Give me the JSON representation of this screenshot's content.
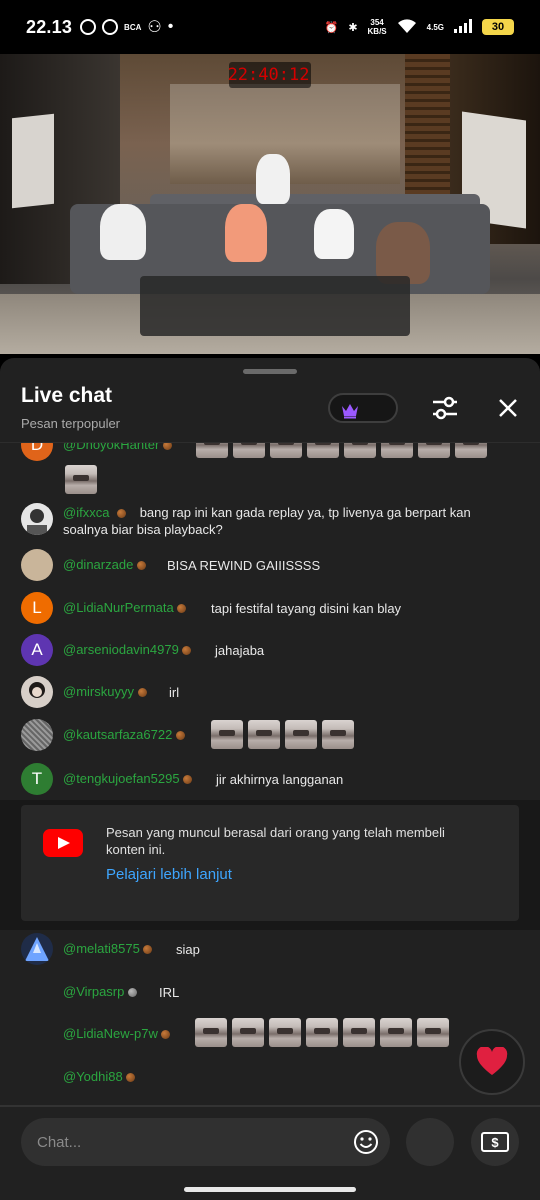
{
  "status_bar": {
    "time": "22.13",
    "bank_label": "BCA",
    "net_speed_value": "354",
    "net_speed_unit": "KB/S",
    "network": "4.5G",
    "battery": "30"
  },
  "video": {
    "timer": "22:40:12"
  },
  "chat": {
    "title": "Live chat",
    "subtitle": "Pesan terpopuler",
    "messages": [
      {
        "author": "@DnoyokHanter",
        "avatar_letter": "D",
        "avatar_color": "#e0641a",
        "text": ""
      },
      {
        "author": "@ifxxca",
        "avatar_letter": "",
        "avatar_color": "#e6e6e6",
        "text": "bang rap ini kan gada replay ya, tp livenya ga berpart kan soalnya biar bisa playback?"
      },
      {
        "author": "@dinarzade",
        "avatar_letter": "",
        "avatar_color": "#c9b59a",
        "text": "BISA REWIND GAIIISSSS"
      },
      {
        "author": "@LidiaNurPermata",
        "avatar_letter": "L",
        "avatar_color": "#ef6c00",
        "text": "tapi festifal tayang disini kan blay"
      },
      {
        "author": "@arseniodavin4979",
        "avatar_letter": "A",
        "avatar_color": "#5e35b1",
        "text": "jahajaba"
      },
      {
        "author": "@mirskuyyy",
        "avatar_letter": "",
        "avatar_color": "#d7cfc8",
        "text": "irl"
      },
      {
        "author": "@kautsarfaza6722",
        "avatar_letter": "",
        "avatar_color": "#7c7c7c",
        "text": ""
      },
      {
        "author": "@tengkujoefan5295",
        "avatar_letter": "T",
        "avatar_color": "#2e7d32",
        "text": "jir akhirnya langganan"
      },
      {
        "author": "@melati8575",
        "avatar_letter": "",
        "avatar_color": "#4a7fd6",
        "text": "siap"
      },
      {
        "author": "@Virpasrp",
        "avatar_letter": "",
        "avatar_color": "",
        "text": "IRL"
      },
      {
        "author": "@LidiaNew-p7w",
        "avatar_letter": "",
        "avatar_color": "",
        "text": ""
      },
      {
        "author": "@Yodhi88",
        "avatar_letter": "",
        "avatar_color": "",
        "text": ""
      }
    ],
    "info": {
      "text": "Pesan yang muncul berasal dari orang yang telah membeli konten ini.",
      "link": "Pelajari lebih lanjut"
    },
    "input_placeholder": "Chat..."
  },
  "colors": {
    "author_green": "#2ba640",
    "link_blue": "#3ea6ff",
    "panel_bg": "#212121",
    "heart_red": "#e02040"
  }
}
